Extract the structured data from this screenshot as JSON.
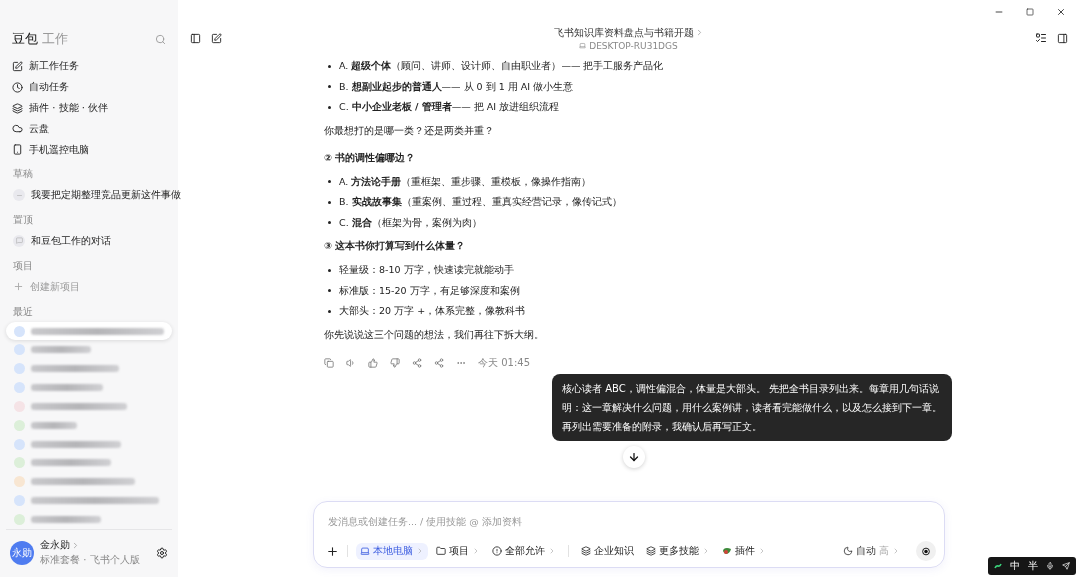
{
  "sidebar": {
    "brand": "豆包",
    "brand_suffix": "工作",
    "nav": [
      {
        "label": "新工作任务"
      },
      {
        "label": "自动任务"
      },
      {
        "label": "插件 · 技能 · 伙伴"
      },
      {
        "label": "云盘"
      },
      {
        "label": "手机遥控电脑"
      }
    ],
    "drafts": {
      "title": "草稿",
      "items": [
        "我要把定期整理竞品更新这件事做"
      ]
    },
    "pinned": {
      "title": "置顶",
      "items": [
        "和豆包工作的对话"
      ]
    },
    "projects": {
      "title": "项目",
      "create": "创建新项目"
    },
    "recent": {
      "title": "最近",
      "items": [
        {
          "color": "#d6e4fb",
          "selected": true
        },
        {
          "color": "#d6e4fb",
          "selected": false
        },
        {
          "color": "#d6e4fb",
          "selected": false
        },
        {
          "color": "#d6e4fb",
          "selected": false
        },
        {
          "color": "#f5e3e6",
          "selected": false
        },
        {
          "color": "#dcefd9",
          "selected": false
        },
        {
          "color": "#d6e4fb",
          "selected": false
        },
        {
          "color": "#dcefd9",
          "selected": false
        },
        {
          "color": "#f8e6d2",
          "selected": false
        },
        {
          "color": "#d6e4fb",
          "selected": false
        },
        {
          "color": "#dcefd9",
          "selected": false
        }
      ]
    },
    "user": {
      "avatar": "永勋",
      "name": "金永勋",
      "plan": "标准套餐 · 飞书个人版"
    }
  },
  "header": {
    "title": "飞书知识库资料盘点与书籍开题",
    "device": "DESKTOP-RU31DGS"
  },
  "answer": [
    {
      "kind": "bullet",
      "text": "A. **超级个体**（顾问、讲师、设计师、自由职业者）—— 把手工服务产品化"
    },
    {
      "kind": "bullet",
      "text": "B. **想副业起步的普通人**—— 从 0 到 1 用 AI 做小生意"
    },
    {
      "kind": "bullet",
      "text": "C. **中小企业老板 / 管理者**—— 把 AI 放进组织流程"
    },
    {
      "kind": "paragraph",
      "text": "你最想打的是哪一类？还是两类并重？"
    },
    {
      "kind": "heading",
      "text": "② 书的调性偏哪边？"
    },
    {
      "kind": "bullet",
      "text": "A. **方法论手册**（重框架、重步骤、重模板，像操作指南）"
    },
    {
      "kind": "bullet",
      "text": "B. **实战故事集**（重案例、重过程、重真实经营记录，像传记式）"
    },
    {
      "kind": "bullet",
      "text": "C. **混合**（框架为骨，案例为肉）"
    },
    {
      "kind": "heading",
      "text": "③ 这本书你打算写到什么体量？"
    },
    {
      "kind": "bullet",
      "text": "轻量级：8-10 万字，快速读完就能动手"
    },
    {
      "kind": "bullet",
      "text": "标准版：15-20 万字，有足够深度和案例"
    },
    {
      "kind": "bullet",
      "text": "大部头：20 万字 +，体系完整，像教科书"
    },
    {
      "kind": "paragraph",
      "text": "你先说说这三个问题的想法，我们再往下拆大纲。"
    }
  ],
  "answer_time": "今天 01:45",
  "user_message": "核心读者 ABC，调性偏混合，体量是大部头。 先把全书目录列出来。每章用几句话说明：这一章解决什么问题，用什么案例讲，读者看完能做什么，以及怎么接到下一章。再列出需要准备的附录，我确认后再写正文。",
  "composer": {
    "placeholder": "发消息或创建任务... / 使用技能 @ 添加资料",
    "tools": [
      {
        "label": "本地电脑",
        "selected": true
      },
      {
        "label": "项目",
        "selected": false
      },
      {
        "label": "全部允许",
        "selected": false
      },
      {
        "label": "企业知识",
        "selected": false
      },
      {
        "label": "更多技能",
        "selected": false
      },
      {
        "label": "插件",
        "selected": false
      }
    ],
    "mode": "自动",
    "mode_level": "高"
  },
  "ime": [
    "中",
    "半"
  ]
}
